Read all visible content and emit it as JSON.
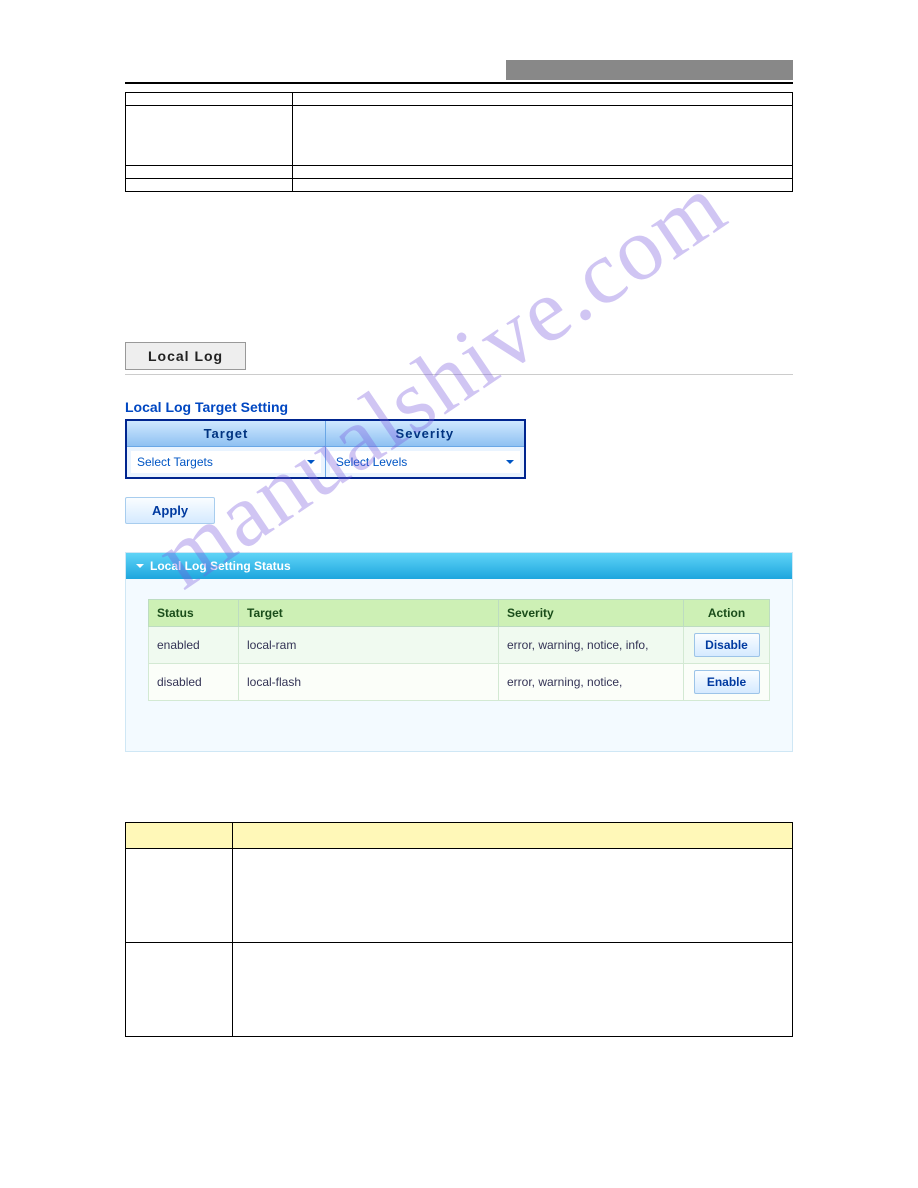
{
  "tab": {
    "label": "Local Log"
  },
  "form": {
    "title": "Local Log Target Setting",
    "headers": {
      "target": "Target",
      "severity": "Severity"
    },
    "targetSelect": "Select Targets",
    "severitySelect": "Select Levels",
    "applyLabel": "Apply"
  },
  "panel": {
    "title": "Local Log Setting Status",
    "headers": {
      "status": "Status",
      "target": "Target",
      "severity": "Severity",
      "action": "Action"
    },
    "rows": [
      {
        "status": "enabled",
        "target": "local-ram",
        "severity": "error, warning, notice, info,",
        "action": "Disable"
      },
      {
        "status": "disabled",
        "target": "local-flash",
        "severity": "error, warning, notice,",
        "action": "Enable"
      }
    ]
  },
  "watermark": "manualshive.com"
}
